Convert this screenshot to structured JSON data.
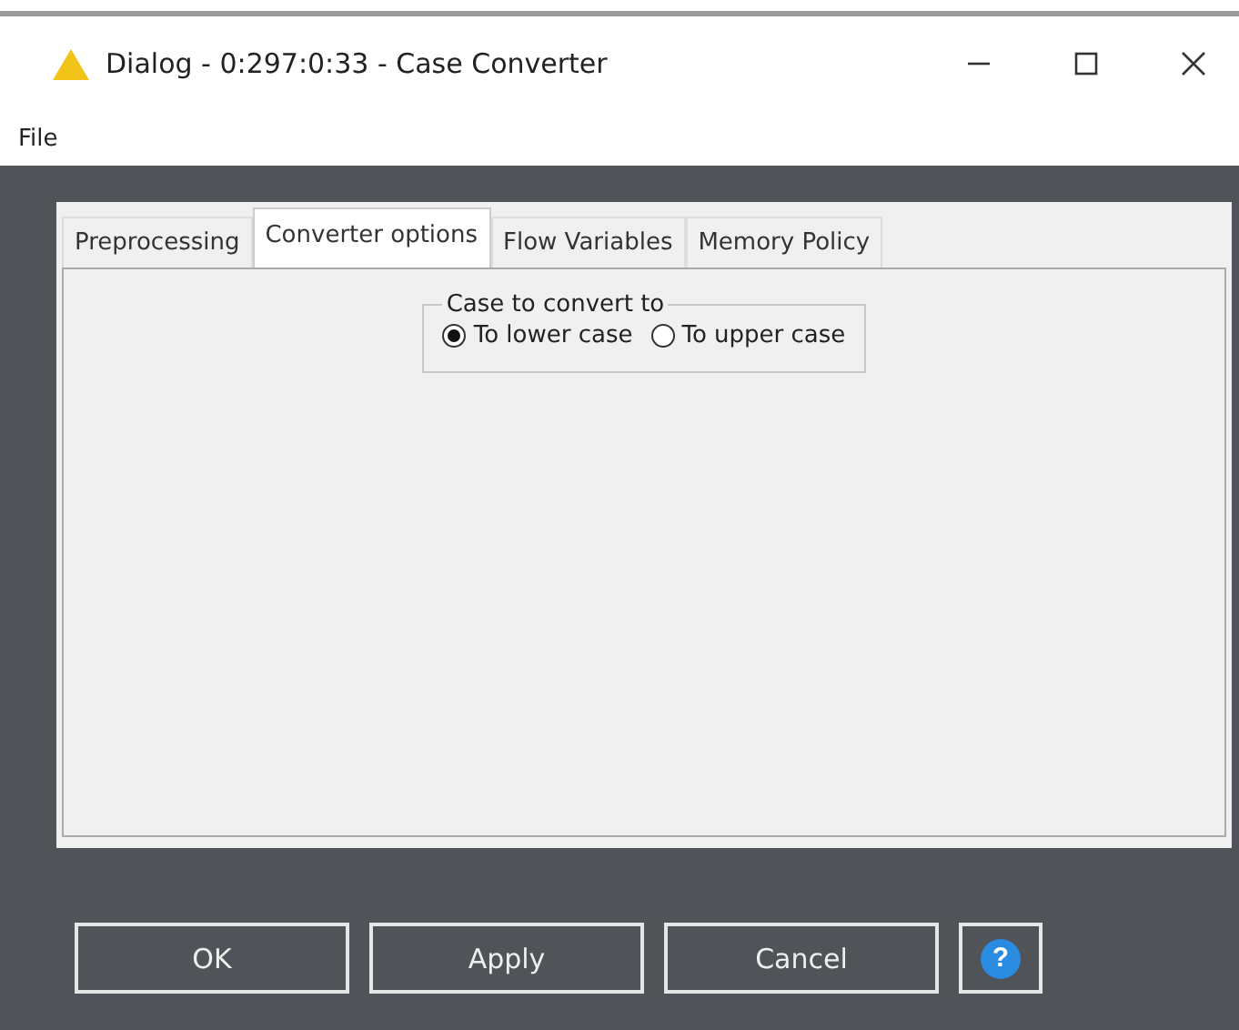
{
  "window": {
    "title": "Dialog - 0:297:0:33 - Case Converter"
  },
  "menu": [
    "File"
  ],
  "tabs": [
    {
      "label": "Preprocessing",
      "selected": false
    },
    {
      "label": "Converter options",
      "selected": true
    },
    {
      "label": "Flow Variables",
      "selected": false
    },
    {
      "label": "Memory Policy",
      "selected": false
    }
  ],
  "group": {
    "title": "Case to convert to",
    "options": [
      {
        "label": "To lower case",
        "selected": true
      },
      {
        "label": "To upper case",
        "selected": false
      }
    ]
  },
  "buttons": [
    "OK",
    "Apply",
    "Cancel"
  ],
  "help": {
    "label": "?"
  }
}
